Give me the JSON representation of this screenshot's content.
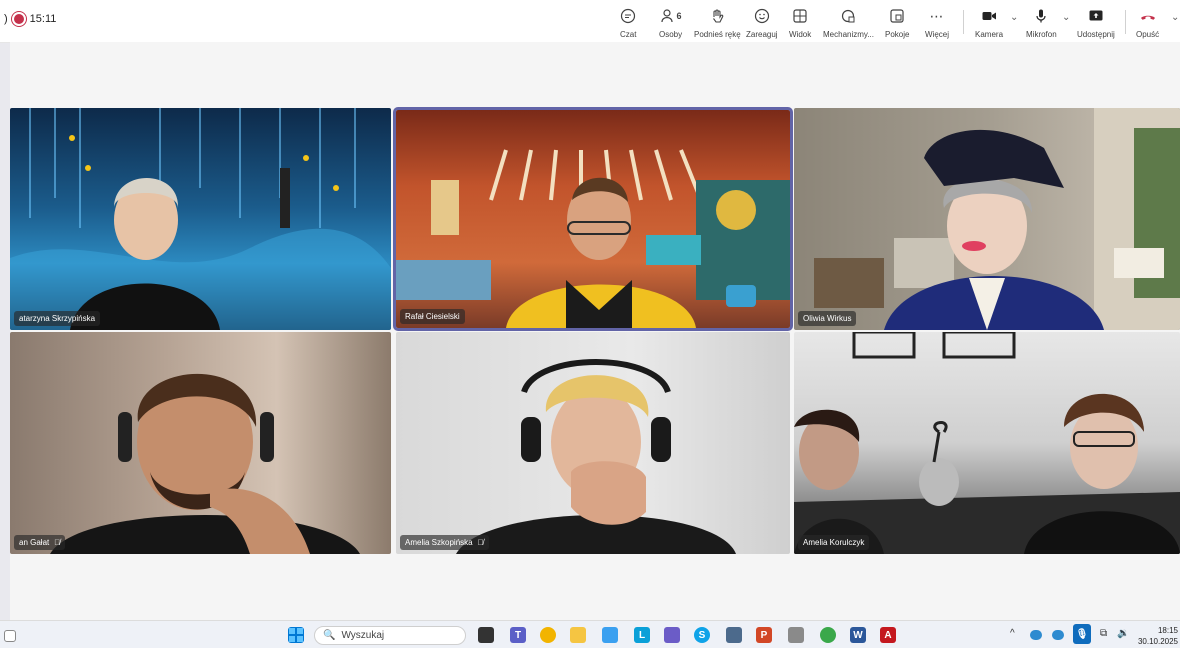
{
  "status": {
    "time": "15:11"
  },
  "toolbar": {
    "chat": "Czat",
    "people": "Osoby",
    "people_count": "6",
    "raise_hand": "Podnieś rękę",
    "react": "Zareaguj",
    "view": "Widok",
    "apps": "Mechanizmy...",
    "rooms": "Pokoje",
    "more": "Więcej",
    "camera": "Kamera",
    "mic": "Mikrofon",
    "share": "Udostępnij",
    "leave": "Opuść"
  },
  "participants": [
    {
      "name": "atarzyna Skrzypińska",
      "muted": false
    },
    {
      "name": "Rafał Ciesielski",
      "muted": false,
      "active_speaker": true
    },
    {
      "name": "Oliwia Wirkus",
      "muted": false
    },
    {
      "name": "an Gałat",
      "muted": true
    },
    {
      "name": "Amelia Szkopińska",
      "muted": true
    },
    {
      "name": "Amelia Korulczyk",
      "muted": false
    }
  ],
  "taskbar": {
    "search_placeholder": "Wyszukaj",
    "time": "18:15",
    "date": "30.10.2025"
  },
  "colors": {
    "accent": "#6264a7",
    "leave": "#c4314b",
    "record": "#c4314b"
  }
}
